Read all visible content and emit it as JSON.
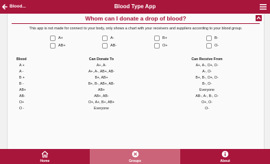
{
  "header": {
    "back_label": "Blood...",
    "title": "Blood Type App"
  },
  "card": {
    "question": "Whom can I donate a drop of blood?",
    "intro": "This app is not made for connect to your body, only shows a chart with your receivers and suppliers according to your blood group."
  },
  "filters": [
    "A+",
    "A-",
    "B+",
    "B-",
    "AB+",
    "AB-",
    "O+",
    "O-"
  ],
  "table": {
    "headers": {
      "blood": "Blood",
      "donate": "Can Donate To",
      "receive": "Can Receive From"
    },
    "rows": [
      {
        "blood": "A +",
        "donate": "A+, A-",
        "receive": "A+, A-, O+, O-"
      },
      {
        "blood": "A -",
        "donate": "A+, A-, AB+, AB-",
        "receive": "A-, O-"
      },
      {
        "blood": "B +",
        "donate": "B+, AB+",
        "receive": "B+, B-, O+, O-"
      },
      {
        "blood": "B -",
        "donate": "B+, B-, AB+, AB-",
        "receive": "B-, O-"
      },
      {
        "blood": "AB+",
        "donate": "AB+",
        "receive": "Everyone"
      },
      {
        "blood": "AB-",
        "donate": "AB+, AB-",
        "receive": "AB-, A-, B-, O-"
      },
      {
        "blood": "O+",
        "donate": "O+, A+, B+, AB+",
        "receive": "O+, O-"
      },
      {
        "blood": "O -",
        "donate": "Everyone",
        "receive": "O-"
      }
    ]
  },
  "nav": {
    "items": [
      {
        "label": "Home",
        "icon": "home-icon"
      },
      {
        "label": "Groups",
        "icon": "groups-icon",
        "active": true
      },
      {
        "label": "About",
        "icon": "info-icon"
      }
    ]
  },
  "colors": {
    "primary": "#a8163c",
    "active_tab": "#cc6479"
  }
}
